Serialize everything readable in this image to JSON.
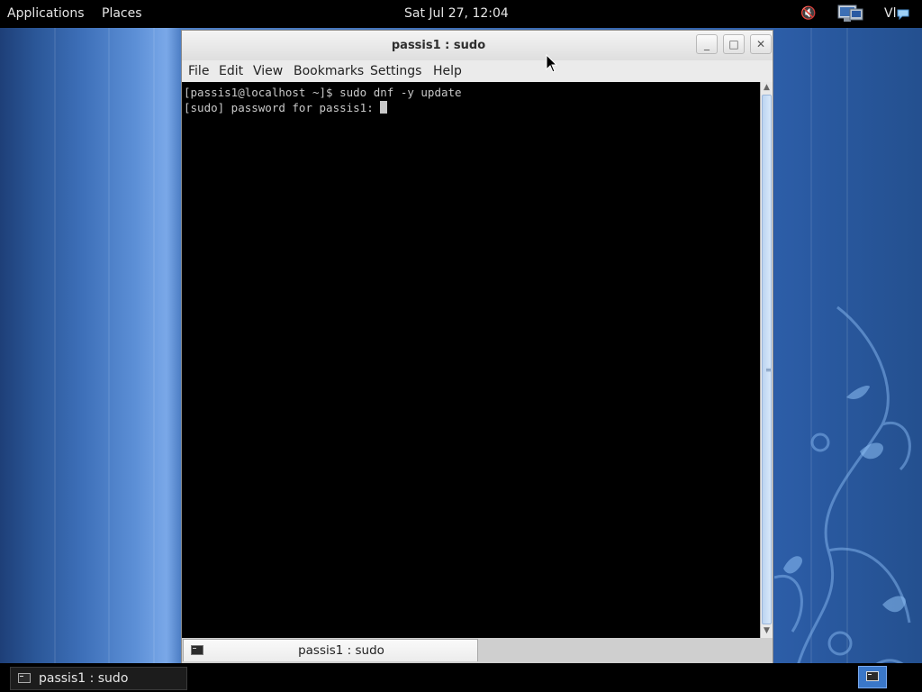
{
  "top_panel": {
    "applications": "Applications",
    "places": "Places",
    "clock": "Sat Jul 27, 12:04",
    "volume_icon": "🔇",
    "user": "Vl"
  },
  "window": {
    "title": "passis1 : sudo",
    "minimize": "_",
    "maximize": "□",
    "close": "✕",
    "menu": [
      "File",
      "Edit",
      "View",
      "Bookmarks",
      "Settings",
      "Help"
    ],
    "terminal_lines": [
      "[passis1@localhost ~]$ sudo dnf -y update",
      "[sudo] password for passis1: "
    ],
    "tab_label": "passis1 : sudo"
  },
  "taskbar": {
    "task_label": "passis1 : sudo"
  },
  "colors": {
    "terminal_bg": "#000000",
    "terminal_fg": "#c8c8c8",
    "desktop_accent": "#2f5da6"
  }
}
